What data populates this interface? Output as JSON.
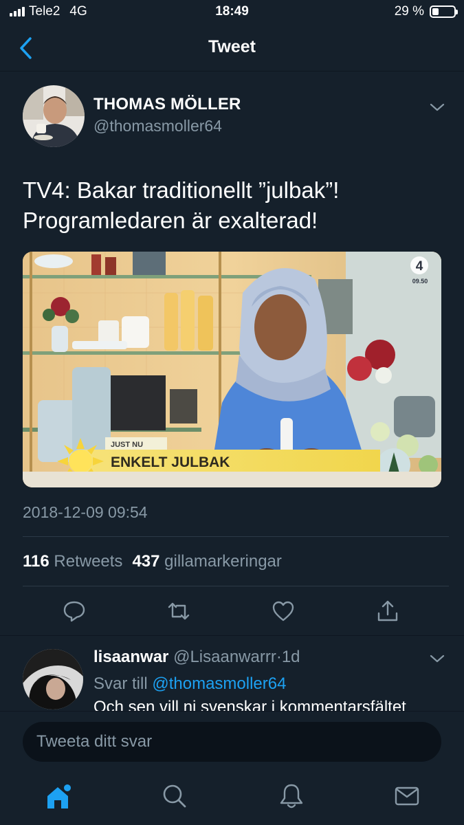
{
  "status_bar": {
    "carrier": "Tele2",
    "network": "4G",
    "time": "18:49",
    "battery_text": "29 %",
    "battery_level": 0.29
  },
  "nav": {
    "title": "Tweet",
    "back_icon": "chevron-left-icon"
  },
  "tweet": {
    "author_name": "THOMAS MÖLLER",
    "author_handle": "@thomasmoller64",
    "text_line1": "TV4: Bakar traditionellt ”julbak”!",
    "text_line2": "Programledaren är exalterad!",
    "media": {
      "channel_logo": "4",
      "clock": "09.50",
      "banner_small": "JUST NU",
      "banner_big": "ENKELT JULBAK"
    },
    "timestamp": "2018-12-09 09:54",
    "retweets_count": "116",
    "retweets_label": "Retweets",
    "likes_count": "437",
    "likes_label": "gillamarkeringar"
  },
  "reply": {
    "name": "lisaanwar",
    "handle": "@Lisaanwarrr",
    "separator": "·",
    "age": "1d",
    "reply_to_label": "Svar till",
    "reply_to_handle": "@thomasmoller64",
    "text": "Och sen vill ni svenskar i kommentarsfältet"
  },
  "composer": {
    "placeholder": "Tweeta ditt svar"
  },
  "tabs": [
    "home-icon",
    "search-icon",
    "notifications-icon",
    "messages-icon"
  ],
  "colors": {
    "background": "#15202b",
    "accent": "#1da1f2",
    "secondary_text": "#8899a6"
  }
}
